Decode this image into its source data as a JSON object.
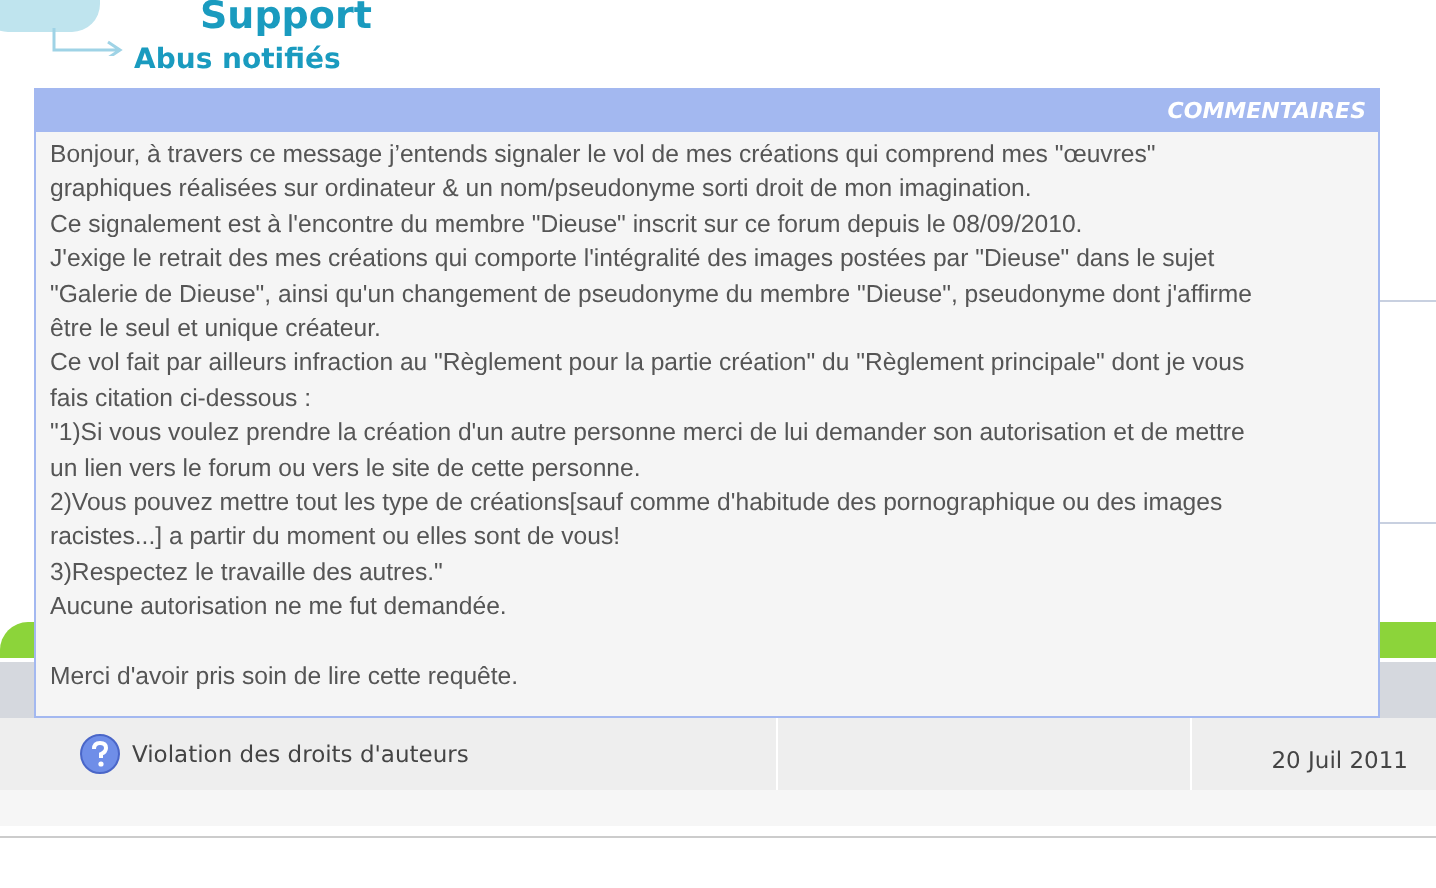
{
  "breadcrumb": {
    "section": "Support",
    "page": "Abus notifiés"
  },
  "popup": {
    "title": "COMMENTAIRES",
    "text": "Bonjour, à travers ce message j’entends signaler le vol de mes créations qui comprend mes \"œuvres\"\ngraphiques réalisées sur ordinateur & un nom/pseudonyme sorti droit de mon imagination.\nCe signalement est à l'encontre du membre \"Dieuse\" inscrit sur ce forum depuis le 08/09/2010.\nJ'exige le retrait des mes créations qui comporte l'intégralité des images postées par \"Dieuse\" dans le sujet\n\"Galerie de Dieuse\", ainsi qu'un changement de pseudonyme du membre \"Dieuse\", pseudonyme dont j'affirme\nêtre le seul et unique créateur.\nCe vol fait par ailleurs infraction au \"Règlement pour la partie création\" du \"Règlement principale\" dont je vous\nfais citation ci-dessous :\n\"1)Si vous voulez prendre la création d'un autre personne merci de lui demander son autorisation et de mettre\nun lien vers le forum ou vers le site de cette personne.\n2)Vous pouvez mettre tout les type de créations[sauf comme d'habitude des pornographique ou des images\nracistes...] a partir du moment ou elles sont de vous!\n3)Respectez le travaille des autres.\"\nAucune autorisation ne me fut demandée.\n\nMerci d'avoir pris soin de lire cette requête."
  },
  "reports": [
    {
      "title": "Violation des droits d'auteurs",
      "date": "20 Juil 2011"
    }
  ]
}
